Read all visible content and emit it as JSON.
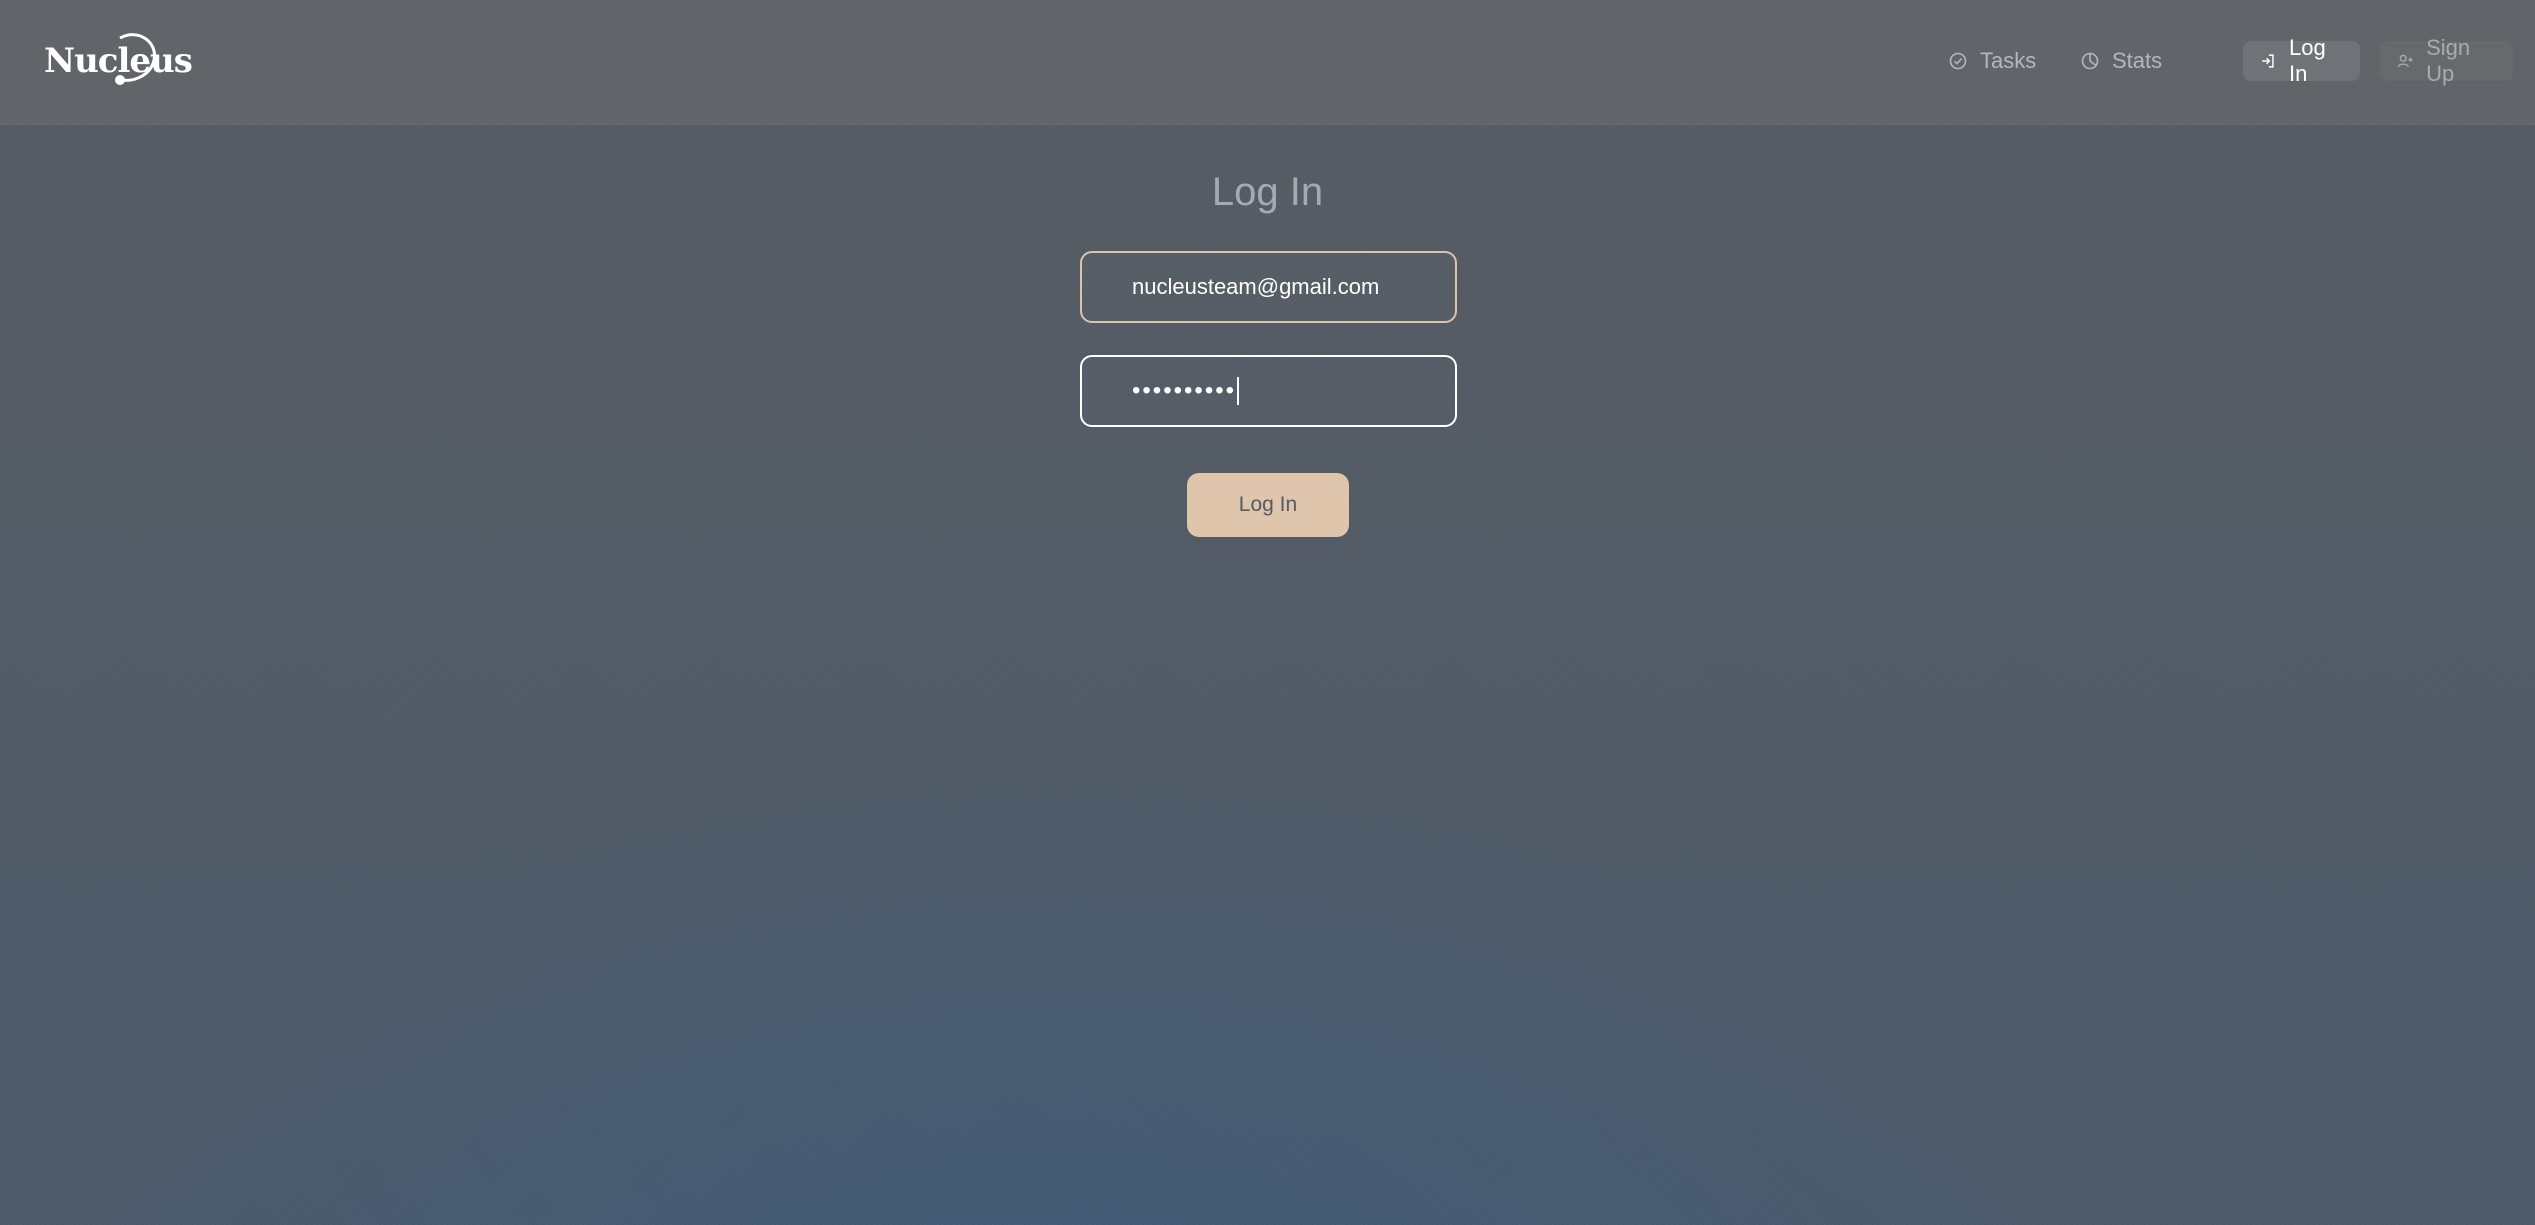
{
  "brand": {
    "name": "Nucleus",
    "icon": "nucleus-logo"
  },
  "nav": {
    "tasks": {
      "label": "Tasks",
      "icon": "check-circle-icon"
    },
    "stats": {
      "label": "Stats",
      "icon": "pie-chart-icon"
    },
    "login": {
      "label": "Log In",
      "icon": "log-in-icon"
    },
    "signup": {
      "label": "Sign Up",
      "icon": "user-plus-icon"
    }
  },
  "form": {
    "title": "Log In",
    "email_value": "nucleusteam@gmail.com",
    "password_masked": "••••••••••",
    "submit_label": "Log In"
  },
  "colors": {
    "accent": "#dfc5ac",
    "header": "#616469",
    "background_top": "#575c63",
    "background_bottom": "#3e5c7c"
  }
}
